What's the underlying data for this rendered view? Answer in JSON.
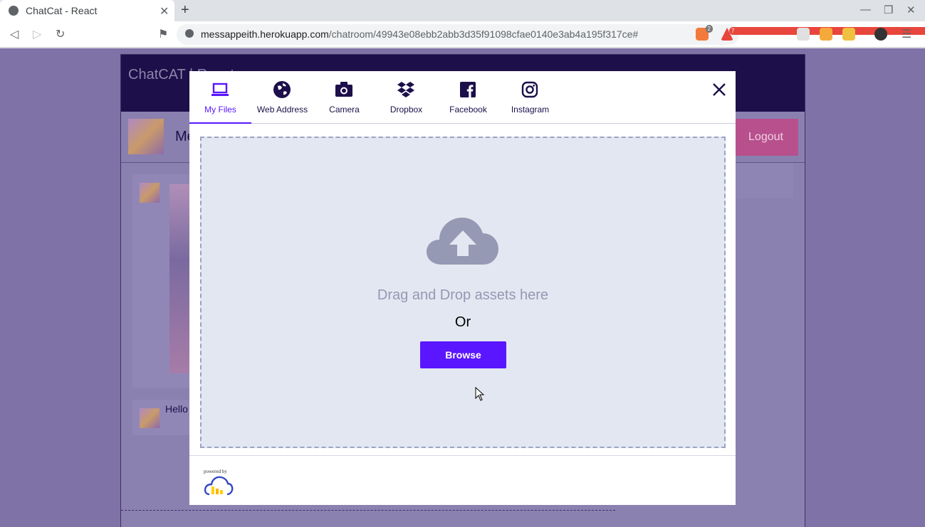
{
  "browser": {
    "tab_title": "ChatCat - React",
    "url_host": "messappeith.herokuapp.com",
    "url_path": "/chatroom/49943e08ebb2abb3d35f91098cfae0140e3ab4a195f317ce#",
    "ext_badge_1": "2",
    "ext_badge_2": "7"
  },
  "app": {
    "title": "ChatCAT | React",
    "user_name_partial": "Me",
    "logout_label": "Logout",
    "message_text_partial": "Hello"
  },
  "modal": {
    "tabs": [
      {
        "label": "My Files",
        "icon": "laptop-icon",
        "active": true
      },
      {
        "label": "Web Address",
        "icon": "globe-icon",
        "active": false
      },
      {
        "label": "Camera",
        "icon": "camera-icon",
        "active": false
      },
      {
        "label": "Dropbox",
        "icon": "dropbox-icon",
        "active": false
      },
      {
        "label": "Facebook",
        "icon": "facebook-icon",
        "active": false
      },
      {
        "label": "Instagram",
        "icon": "instagram-icon",
        "active": false
      }
    ],
    "drag_text": "Drag and Drop assets here",
    "or_text": "Or",
    "browse_label": "Browse",
    "powered_by": "powered by"
  },
  "colors": {
    "accent": "#5a16ff",
    "overlay": "#7e72a6",
    "header": "#1c0f4a"
  }
}
